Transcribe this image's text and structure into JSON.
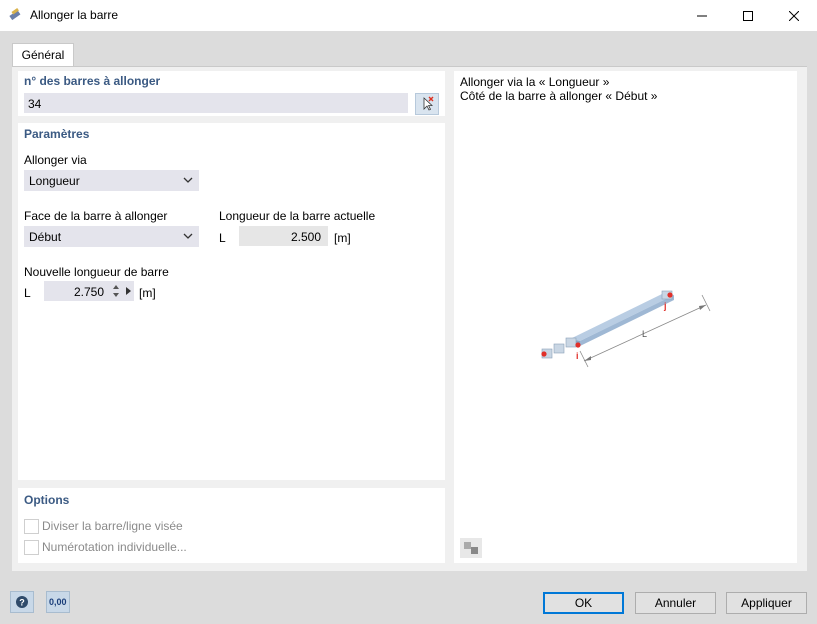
{
  "window": {
    "title": "Allonger la barre",
    "minimize_icon": "minimize-icon",
    "maximize_icon": "maximize-icon",
    "close_icon": "close-icon"
  },
  "tabs": [
    {
      "label": "Général",
      "active": true
    }
  ],
  "members": {
    "heading": "n° des barres à allonger",
    "value": "34"
  },
  "params": {
    "heading": "Paramètres",
    "extend_via_label": "Allonger via",
    "extend_via_value": "Longueur",
    "face_label": "Face de la barre à allonger",
    "face_value": "Début",
    "current_length_label": "Longueur de la barre actuelle",
    "current_symbol": "L",
    "current_value": "2.500",
    "current_unit": "[m]",
    "new_length_label": "Nouvelle longueur de barre",
    "new_symbol": "L",
    "new_value": "2.750",
    "new_unit": "[m]"
  },
  "options": {
    "heading": "Options",
    "divide_label": "Diviser la barre/ligne visée",
    "divide_checked": false,
    "numbering_label": "Numérotation individuelle...",
    "numbering_checked": false
  },
  "preview": {
    "line1": "Allonger via la « Longueur »",
    "line2": "Côté de la barre à allonger « Début »",
    "node_start": "i",
    "node_end": "j",
    "dim_label": "L"
  },
  "footer": {
    "ok": "OK",
    "cancel": "Annuler",
    "apply": "Appliquer",
    "units_icon_text": "0,00"
  },
  "colors": {
    "section_title": "#3b5a83",
    "accent": "#0078d7",
    "node_red": "#e0302a"
  }
}
